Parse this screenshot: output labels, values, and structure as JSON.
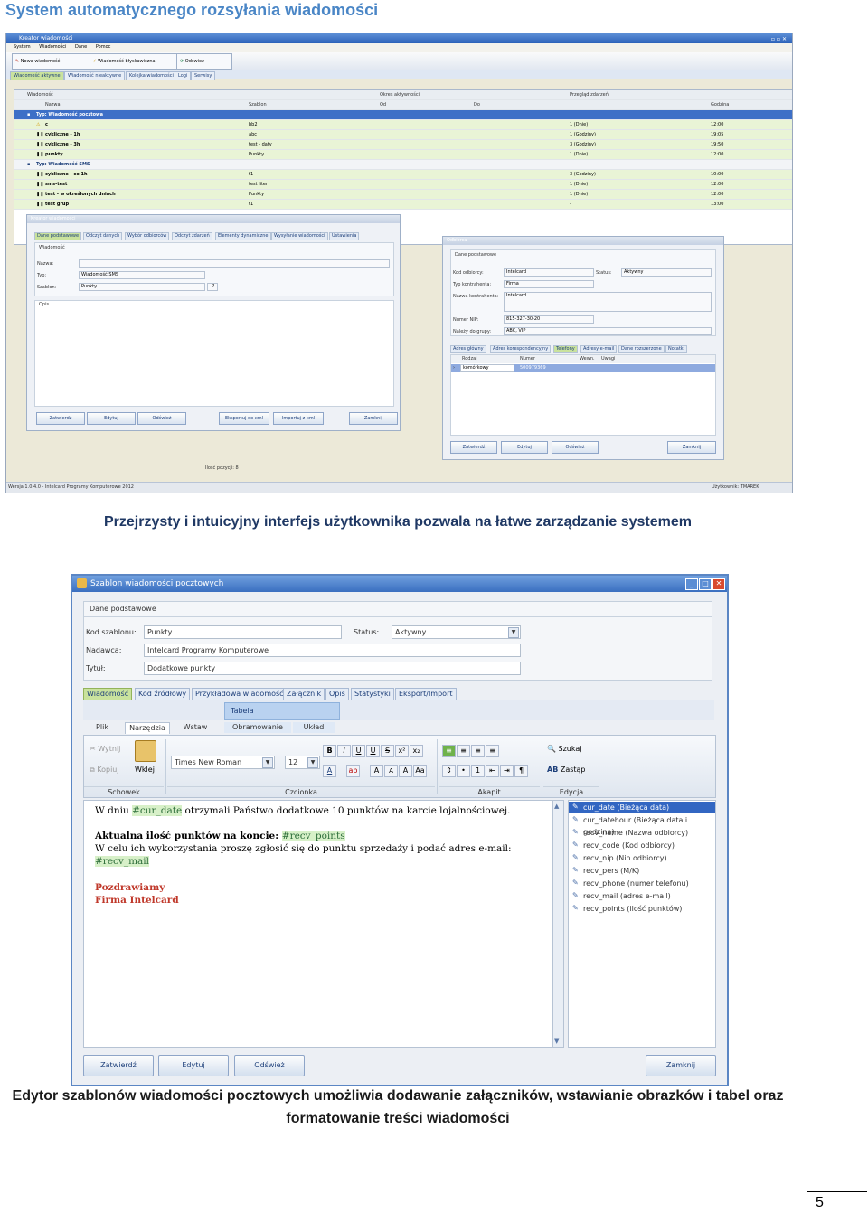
{
  "heading": "System automatycznego rozsyłania wiadomości",
  "caption1": "Przejrzysty i intuicyjny interfejs użytkownika pozwala na łatwe zarządzanie systemem",
  "caption2_line1": "Edytor szablonów wiadomości pocztowych umożliwia dodawanie załączników, wstawianie obrazków i tabel oraz",
  "caption2_line2": "formatowanie treści wiadomości",
  "page_number": "5",
  "shot1": {
    "title": "Kreator wiadomości",
    "menu": [
      "System",
      "Wiadomości",
      "Dane",
      "Pomoc"
    ],
    "toolbar": [
      "Nowa wiadomość",
      "Wiadomość błyskawiczna",
      "Odśwież"
    ],
    "tabs": [
      "Wiadomość aktywne",
      "Wiadomość nieaktywne",
      "Kolejka wiadomości",
      "Logi",
      "Serwisy"
    ],
    "col_groups": [
      "Wiadomość",
      "Okres aktywności",
      "Przegląd zdarzeń"
    ],
    "cols": [
      "Nazwa",
      "Szablon",
      "Od",
      "Do",
      "Godzina"
    ],
    "group1": "Typ: Wiadomość pocztowa",
    "group2": "Typ: Wiadomość SMS",
    "rows1": [
      {
        "n": "c",
        "s": "bb2",
        "p": "1 (Dnie)",
        "g": "12:00"
      },
      {
        "n": "cykliczne - 1h",
        "s": "abc",
        "p": "1 (Godziny)",
        "g": "19:05"
      },
      {
        "n": "cykliczne - 3h",
        "s": "test - daty",
        "p": "3 (Godziny)",
        "g": "19:50"
      },
      {
        "n": "punkty",
        "s": "Punkty",
        "p": "1 (Dnie)",
        "g": "12:00"
      }
    ],
    "rows2": [
      {
        "n": "cykliczne - co 1h",
        "s": "t1",
        "p": "3 (Godziny)",
        "g": "10:00"
      },
      {
        "n": "sms-test",
        "s": "test liter",
        "p": "1 (Dnie)",
        "g": "12:00"
      },
      {
        "n": "test - w określonych dniach",
        "s": "Punkty",
        "p": "1 (Dnie)",
        "g": "12:00"
      },
      {
        "n": "test grup",
        "s": "t1",
        "p": "-",
        "g": "13:00"
      }
    ],
    "kreator": {
      "title": "Kreator wiadomości",
      "tabs": [
        "Dane podstawowe",
        "Odczyt danych",
        "Wybór odbiorców",
        "Odczyt zdarzeń",
        "Elementy dynamiczne",
        "Wysyłanie wiadomości",
        "Ustawienia"
      ],
      "section": "Wiadomość",
      "name_label": "Nazwa:",
      "type_label": "Typ:",
      "type_value": "Wiadomość SMS",
      "tpl_label": "Szablon:",
      "tpl_value": "Punkty",
      "desc_label": "Opis",
      "buttons": [
        "Zatwierdź",
        "Edytuj",
        "Odśwież",
        "Eksportuj do xml",
        "Importuj z xml",
        "Zamknij"
      ]
    },
    "odbiorca": {
      "title": "Odbiorca",
      "section": "Dane podstawowe",
      "code_label": "Kod odbiorcy:",
      "code_value": "Intelcard",
      "status_label": "Status:",
      "status_value": "Aktywny",
      "type_label": "Typ kontrahenta:",
      "type_value": "Firma",
      "name_label": "Nazwa kontrahenta:",
      "name_value": "Intelcard",
      "nip_label": "Numer NIP:",
      "nip_value": "815-327-30-20",
      "group_label": "Należy do grupy:",
      "group_value": "ABC, VIP",
      "tabs": [
        "Adres główny",
        "Adres korespondencyjny",
        "Telefony",
        "Adresy e-mail",
        "Dane rozszerzone",
        "Notatki"
      ],
      "cols": [
        "Rodzaj",
        "Numer",
        "Wewn.",
        "Uwagi"
      ],
      "row_kind": "komórkowy",
      "row_number": "500979369",
      "buttons": [
        "Zatwierdź",
        "Edytuj",
        "Odśwież",
        "Zamknij"
      ]
    },
    "count": "Ilość pozycji: 8",
    "status_left": "Wersja 1.0.4.0 - Intelcard Programy Komputerowe 2012",
    "status_right": "Użytkownik: TMAREK"
  },
  "shot2": {
    "title": "Szablon wiadomości pocztowych",
    "section": "Dane podstawowe",
    "code_label": "Kod szablonu:",
    "code_value": "Punkty",
    "status_label": "Status:",
    "status_value": "Aktywny",
    "sender_label": "Nadawca:",
    "sender_value": "Intelcard Programy Komputerowe",
    "subject_label": "Tytuł:",
    "subject_value": "Dodatkowe punkty",
    "tabs": [
      "Wiadomość",
      "Kod źródłowy",
      "Przykładowa wiadomość",
      "Załącznik",
      "Opis",
      "Statystyki",
      "Eksport/Import"
    ],
    "table_tab": "Tabela",
    "ribbon_tabs": [
      "Plik",
      "Narzędzia",
      "Wstaw",
      "Obramowanie",
      "Układ"
    ],
    "cut": "Wytnij",
    "copy": "Kopiuj",
    "paste": "Wklej",
    "font": "Times New Roman",
    "size": "12",
    "find": "Szukaj",
    "replace": "Zastąp",
    "groups": [
      "Schowek",
      "Czcionka",
      "Akapit",
      "Edycja"
    ],
    "body": {
      "l1a": "W dniu ",
      "l1tag": "#cur_date",
      "l1b": " otrzymali Państwo dodatkowe 10 punktów na karcie lojalnościowej.",
      "l2a": "Aktualna ilość punktów na koncie: ",
      "l2tag": "#recv_points",
      "l3": "W celu ich wykorzystania proszę zgłosić się do punktu sprzedaży i podać adres e-mail:",
      "l4tag": "#recv_mail",
      "l5": "Pozdrawiamy",
      "l6": "Firma Intelcard"
    },
    "vars": [
      "cur_date (Bieżąca data)",
      "cur_datehour (Bieżąca data i godzina)",
      "recv_name (Nazwa odbiorcy)",
      "recv_code (Kod odbiorcy)",
      "recv_nip (Nip odbiorcy)",
      "recv_pers (M/K)",
      "recv_phone (numer telefonu)",
      "recv_mail (adres e-mail)",
      "recv_points (ilość punktów)"
    ],
    "buttons": [
      "Zatwierdź",
      "Edytuj",
      "Odśwież",
      "Zamknij"
    ]
  }
}
